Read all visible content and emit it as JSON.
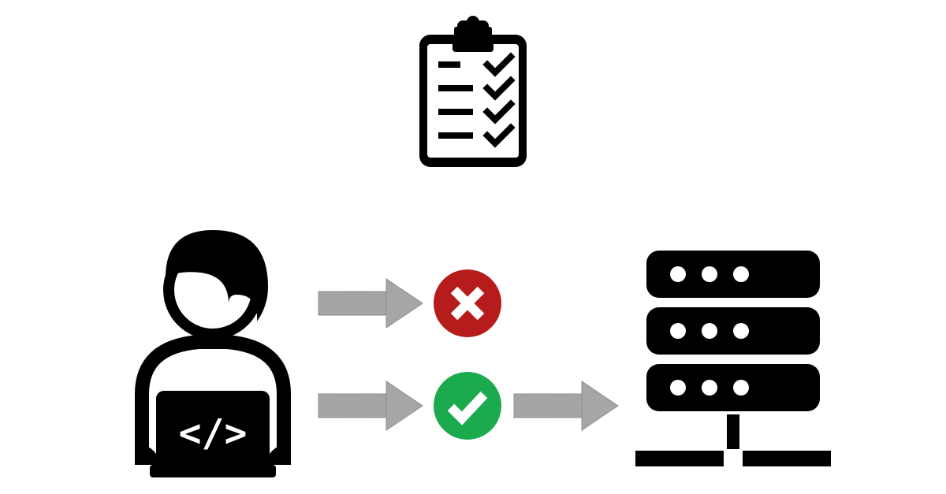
{
  "icons": {
    "clipboard": "clipboard-checklist-icon",
    "developer": "developer-laptop-icon",
    "arrow": "arrow-right-icon",
    "reject": "x-circle-icon",
    "accept": "check-circle-icon",
    "server": "server-stack-icon"
  },
  "colors": {
    "black": "#000000",
    "gray": "#a6a6a6",
    "red": "#b71c1c",
    "green": "#1baa4e",
    "white": "#ffffff"
  },
  "code_glyph": "</>"
}
